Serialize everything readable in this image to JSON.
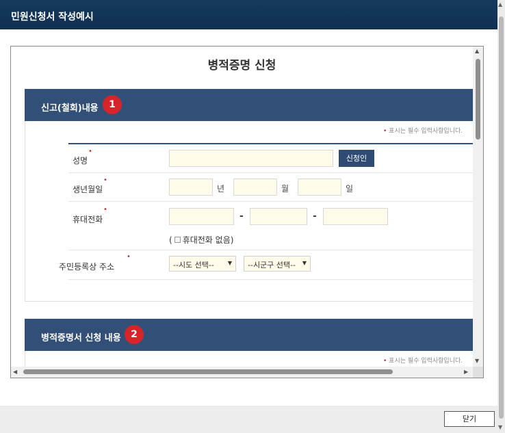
{
  "window": {
    "title": "민원신청서 작성예시"
  },
  "document": {
    "title": "병적증명 신청"
  },
  "section1": {
    "title": "신고(철회)내용",
    "number": "1",
    "required_note": "표시는 필수 입력사항입니다.",
    "fields": {
      "name_label": "성명",
      "applicant_button": "신청인",
      "birth_label": "생년월일",
      "year_unit": "년",
      "month_unit": "월",
      "day_unit": "일",
      "phone_label": "휴대전화",
      "dash": "-",
      "no_phone_open": "(",
      "no_phone_label": "휴대전화 없음",
      "no_phone_close": ")",
      "address_label": "주민등록상 주소",
      "sido_select": "--시도 선택--",
      "sigungu_select": "--시군구 선택--"
    }
  },
  "section2": {
    "title": "병적증명서 신청 내용",
    "number": "2",
    "required_note": "표시는 필수 입력사항입니다."
  },
  "footer": {
    "close_button": "닫기"
  },
  "colors": {
    "header": "#0f2f50",
    "section": "#324f78",
    "badge": "#d72428",
    "input_bg": "#fffbea"
  }
}
